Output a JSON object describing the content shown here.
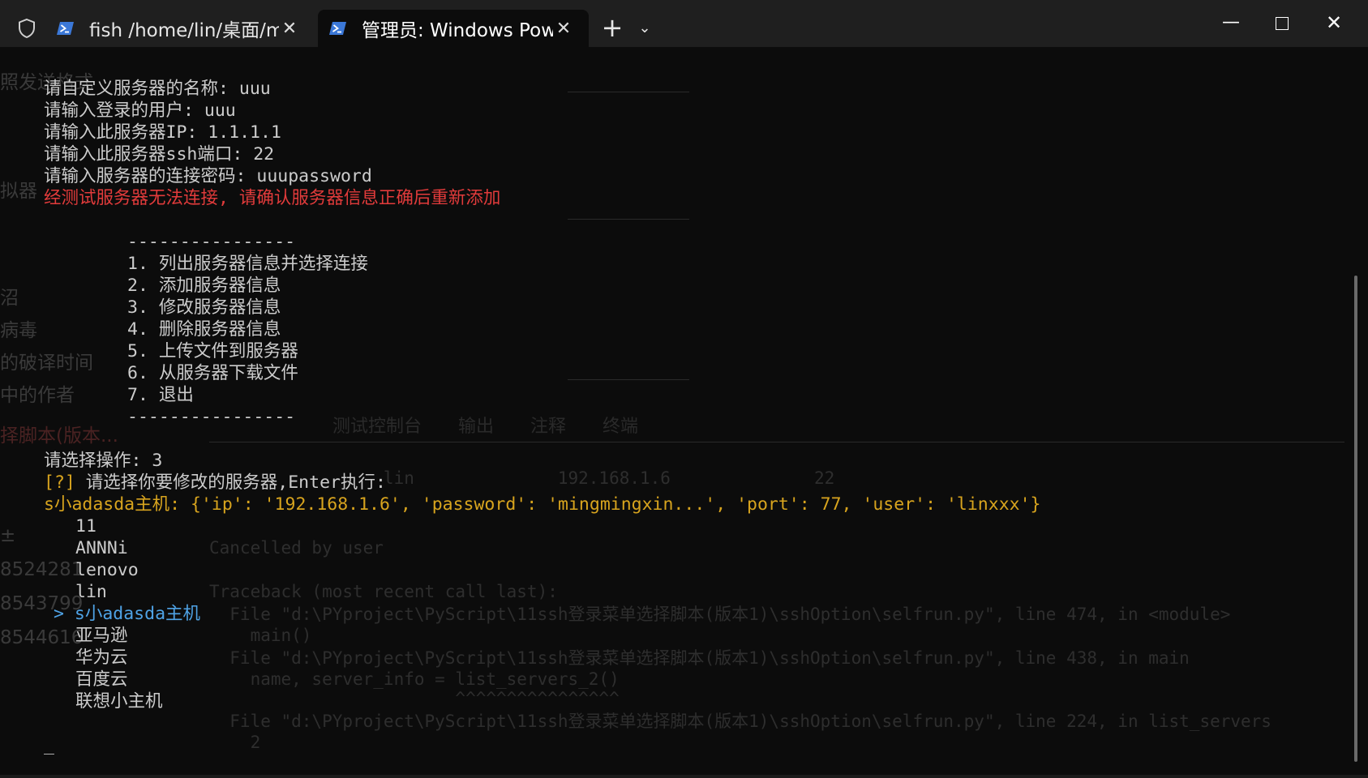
{
  "window": {
    "tabs": [
      {
        "title": "fish /home/lin/桌面/m",
        "active": false
      },
      {
        "title": "管理员: Windows Pow",
        "active": true
      }
    ],
    "new_tab": "+",
    "dropdown": "⌄",
    "minimize": "—",
    "close": "✕"
  },
  "terminal": {
    "prompts": [
      "请自定义服务器的名称: uuu",
      "请输入登录的用户: uuu",
      "请输入此服务器IP: 1.1.1.1",
      "请输入此服务器ssh端口: 22",
      "请输入服务器的连接密码: uuupassword"
    ],
    "error": "经测试服务器无法连接, 请确认服务器信息正确后重新添加",
    "menu_divider": "----------------",
    "menu": [
      "1. 列出服务器信息并选择连接",
      "2. 添加服务器信息",
      "3. 修改服务器信息",
      "4. 删除服务器信息",
      "5. 上传文件到服务器",
      "6. 从服务器下载文件",
      "7. 退出"
    ],
    "choose_op": "请选择操作: 3",
    "question_mark": "[?]",
    "question": " 请选择你要修改的服务器,Enter执行:",
    "selected_detail": "s小adasda主机: {'ip': '192.168.1.6', 'password': 'mingmingxin...', 'port': 77, 'user': 'linxxx'}",
    "servers_before": [
      "11",
      "ANNNi",
      "lenovo",
      "lin"
    ],
    "pointer": ">",
    "selected_server": "s小adasda主机",
    "servers_after": [
      "亚马逊",
      "华为云",
      "百度云",
      "联想小主机"
    ],
    "cursor": "_"
  },
  "colors": {
    "background": "#0c0c0c",
    "titlebar": "#1f1f1f",
    "text": "#cccccc",
    "error": "#e23b3b",
    "highlight": "#d8a41e",
    "selection": "#4fa3e6"
  }
}
